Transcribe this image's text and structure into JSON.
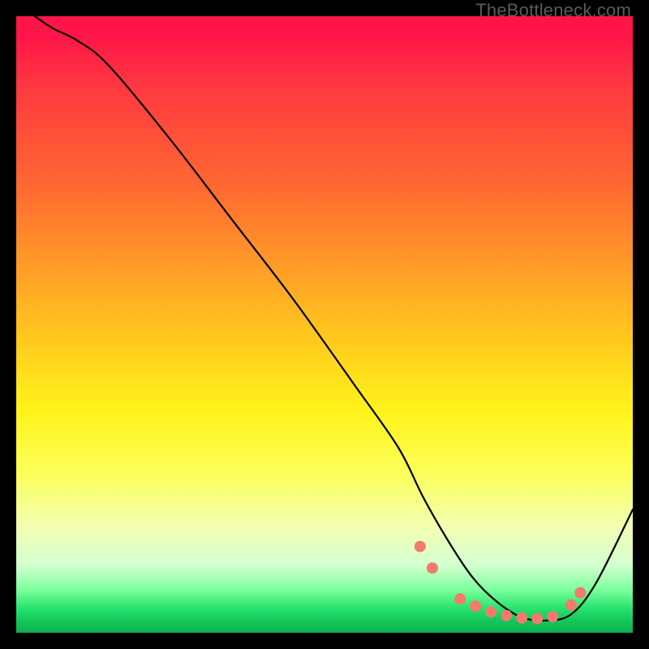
{
  "watermark": "TheBottleneck.com",
  "chart_data": {
    "type": "line",
    "title": "",
    "xlabel": "",
    "ylabel": "",
    "xlim": [
      0,
      100
    ],
    "ylim": [
      0,
      100
    ],
    "grid": false,
    "series": [
      {
        "name": "curve",
        "x": [
          3,
          6,
          10,
          15,
          25,
          35,
          45,
          55,
          62,
          66,
          70,
          74,
          78,
          82,
          86,
          90,
          94,
          100
        ],
        "y": [
          100,
          98,
          96,
          92,
          80,
          67,
          54,
          40,
          30,
          22,
          15,
          9,
          5,
          2.5,
          2,
          3,
          8,
          20
        ]
      }
    ],
    "markers": {
      "name": "dots",
      "color": "#f37a6d",
      "points": [
        {
          "x": 65.5,
          "y": 14
        },
        {
          "x": 67.5,
          "y": 10.5
        },
        {
          "x": 72,
          "y": 5.5
        },
        {
          "x": 74.5,
          "y": 4.3
        },
        {
          "x": 77,
          "y": 3.4
        },
        {
          "x": 79.5,
          "y": 2.8
        },
        {
          "x": 82,
          "y": 2.4
        },
        {
          "x": 84.5,
          "y": 2.3
        },
        {
          "x": 87,
          "y": 2.6
        },
        {
          "x": 90,
          "y": 4.5
        },
        {
          "x": 91.5,
          "y": 6.5
        }
      ]
    }
  }
}
